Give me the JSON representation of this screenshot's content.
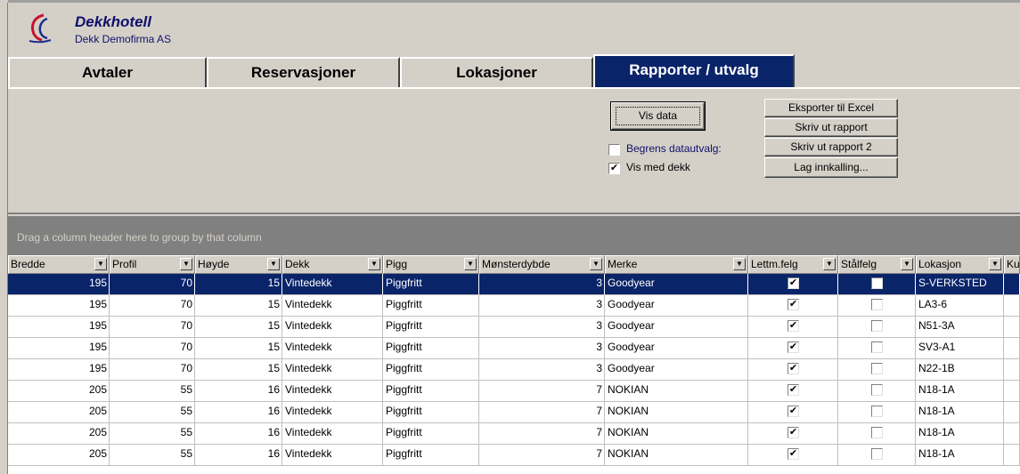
{
  "app": {
    "title": "Dekkhotell",
    "company": "Dekk Demofirma AS"
  },
  "tabs": [
    {
      "label": "Avtaler",
      "active": false
    },
    {
      "label": "Reservasjoner",
      "active": false
    },
    {
      "label": "Lokasjoner",
      "active": false
    },
    {
      "label": "Rapporter / utvalg",
      "active": true
    }
  ],
  "panel": {
    "vis_data": "Vis data",
    "begrens_label": "Begrens datautvalg:",
    "begrens_checked": false,
    "vis_med_dekk_label": "Vis med dekk",
    "vis_med_dekk_checked": true,
    "export_excel": "Eksporter til Excel",
    "print_report": "Skriv ut rapport",
    "print_report2": "Skriv ut rapport 2",
    "lag_innkalling": "Lag innkalling..."
  },
  "grid": {
    "group_hint": "Drag a column header here to group by that column",
    "columns": [
      "Bredde",
      "Profil",
      "Høyde",
      "Dekk",
      "Pigg",
      "Mønsterdybde",
      "Merke",
      "Lettm.felg",
      "Stålfelg",
      "Lokasjon",
      "Ku"
    ],
    "rows": [
      {
        "bredde": "195",
        "profil": "70",
        "hoyde": "15",
        "dekk": "Vintedekk",
        "pigg": "Piggfritt",
        "monster": "3",
        "merke": "Goodyear",
        "lettm": true,
        "stal": false,
        "lokasjon": "S-VERKSTED",
        "selected": true
      },
      {
        "bredde": "195",
        "profil": "70",
        "hoyde": "15",
        "dekk": "Vintedekk",
        "pigg": "Piggfritt",
        "monster": "3",
        "merke": "Goodyear",
        "lettm": true,
        "stal": false,
        "lokasjon": "LA3-6",
        "selected": false
      },
      {
        "bredde": "195",
        "profil": "70",
        "hoyde": "15",
        "dekk": "Vintedekk",
        "pigg": "Piggfritt",
        "monster": "3",
        "merke": "Goodyear",
        "lettm": true,
        "stal": false,
        "lokasjon": "N51-3A",
        "selected": false
      },
      {
        "bredde": "195",
        "profil": "70",
        "hoyde": "15",
        "dekk": "Vintedekk",
        "pigg": "Piggfritt",
        "monster": "3",
        "merke": "Goodyear",
        "lettm": true,
        "stal": false,
        "lokasjon": "SV3-A1",
        "selected": false
      },
      {
        "bredde": "195",
        "profil": "70",
        "hoyde": "15",
        "dekk": "Vintedekk",
        "pigg": "Piggfritt",
        "monster": "3",
        "merke": "Goodyear",
        "lettm": true,
        "stal": false,
        "lokasjon": "N22-1B",
        "selected": false
      },
      {
        "bredde": "205",
        "profil": "55",
        "hoyde": "16",
        "dekk": "Vintedekk",
        "pigg": "Piggfritt",
        "monster": "7",
        "merke": "NOKIAN",
        "lettm": true,
        "stal": false,
        "lokasjon": "N18-1A",
        "selected": false
      },
      {
        "bredde": "205",
        "profil": "55",
        "hoyde": "16",
        "dekk": "Vintedekk",
        "pigg": "Piggfritt",
        "monster": "7",
        "merke": "NOKIAN",
        "lettm": true,
        "stal": false,
        "lokasjon": "N18-1A",
        "selected": false
      },
      {
        "bredde": "205",
        "profil": "55",
        "hoyde": "16",
        "dekk": "Vintedekk",
        "pigg": "Piggfritt",
        "monster": "7",
        "merke": "NOKIAN",
        "lettm": true,
        "stal": false,
        "lokasjon": "N18-1A",
        "selected": false
      },
      {
        "bredde": "205",
        "profil": "55",
        "hoyde": "16",
        "dekk": "Vintedekk",
        "pigg": "Piggfritt",
        "monster": "7",
        "merke": "NOKIAN",
        "lettm": true,
        "stal": false,
        "lokasjon": "N18-1A",
        "selected": false
      }
    ]
  },
  "colors": {
    "selection": "#0a246a",
    "face": "#d4d0c8",
    "title": "#10106b"
  }
}
